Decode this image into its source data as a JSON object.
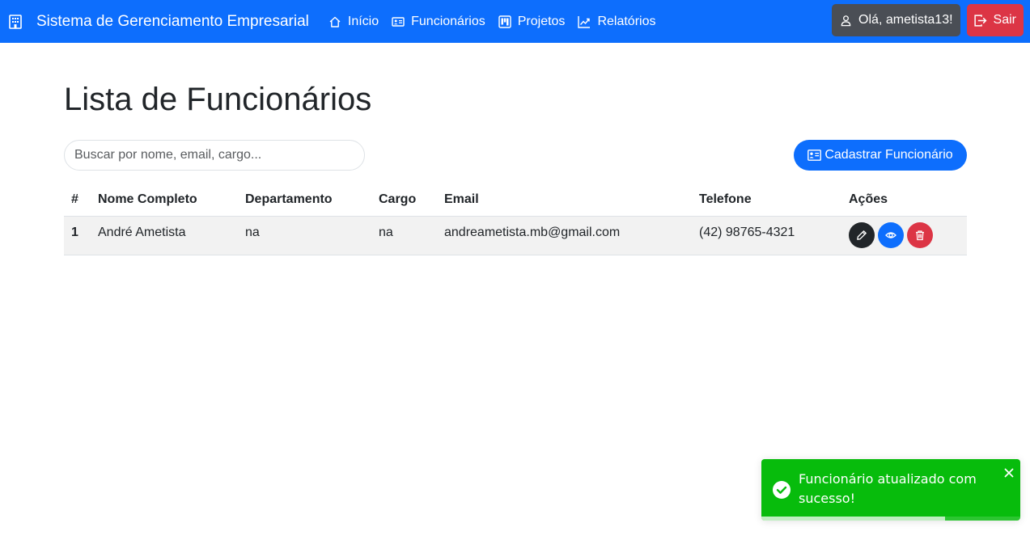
{
  "navbar": {
    "brand_icon": "building-icon",
    "brand": "Sistema de Gerenciamento Empresarial",
    "links": [
      {
        "label": "Início",
        "icon": "house-icon"
      },
      {
        "label": "Funcionários",
        "icon": "person-vcard-icon"
      },
      {
        "label": "Projetos",
        "icon": "kanban-icon"
      },
      {
        "label": "Relatórios",
        "icon": "graph-up-icon"
      }
    ],
    "user_label": "Olá, ametista13!",
    "logout_label": "Sair"
  },
  "page": {
    "title": "Lista de Funcionários",
    "search_placeholder": "Buscar por nome, email, cargo...",
    "register_label": "Cadastrar Funcionário"
  },
  "table": {
    "columns": [
      "#",
      "Nome Completo",
      "Departamento",
      "Cargo",
      "Email",
      "Telefone",
      "Ações"
    ],
    "rows": [
      {
        "index": "1",
        "name": "André Ametista",
        "department": "na",
        "role": "na",
        "email": "andreametista.mb@gmail.com",
        "phone": "(42) 98765-4321"
      }
    ]
  },
  "toast": {
    "message": "Funcionário atualizado com sucesso!",
    "progress": 0.71
  },
  "colors": {
    "primary": "#0d6efd",
    "danger": "#dc3545",
    "dark": "#212529",
    "user_button": "#4a4e55",
    "toast_success": "#07bc0c"
  }
}
